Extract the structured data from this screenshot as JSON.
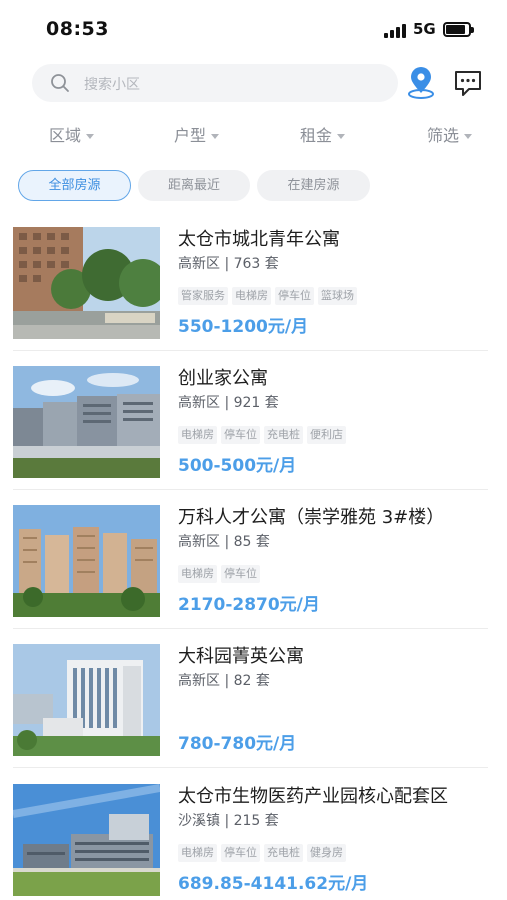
{
  "status_bar": {
    "time": "08:53",
    "network": "5G",
    "battery_level": 0.8
  },
  "search": {
    "placeholder": "搜索小区"
  },
  "filters": [
    {
      "label": "区域"
    },
    {
      "label": "户型"
    },
    {
      "label": "租金"
    },
    {
      "label": "筛选"
    }
  ],
  "chips": [
    {
      "label": "全部房源",
      "active": true
    },
    {
      "label": "距离最近",
      "active": false
    },
    {
      "label": "在建房源",
      "active": false
    }
  ],
  "listings": [
    {
      "title": "太仓市城北青年公寓",
      "subtitle": "高新区 | 763 套",
      "tags": [
        "管家服务",
        "电梯房",
        "停车位",
        "篮球场"
      ],
      "price": "550-1200元/月",
      "image": "highrise-street-photo"
    },
    {
      "title": "创业家公寓",
      "subtitle": "高新区 | 921 套",
      "tags": [
        "电梯房",
        "停车位",
        "充电桩",
        "便利店"
      ],
      "price": "500-500元/月",
      "image": "office-complex-photo"
    },
    {
      "title": "万科人才公寓（崇学雅苑 3#楼）",
      "subtitle": "高新区 | 85 套",
      "tags": [
        "电梯房",
        "停车位"
      ],
      "price": "2170-2870元/月",
      "image": "residential-towers-photo"
    },
    {
      "title": "大科园菁英公寓",
      "subtitle": "高新区 | 82 套",
      "tags": [],
      "price": "780-780元/月",
      "image": "apartment-block-photo"
    },
    {
      "title": "太仓市生物医药产业园核心配套区",
      "subtitle": "沙溪镇 | 215 套",
      "tags": [
        "电梯房",
        "停车位",
        "充电桩",
        "健身房"
      ],
      "price": "689.85-4141.62元/月",
      "image": "industrial-park-photo"
    }
  ],
  "colors": {
    "accent": "#4c9ee8",
    "chip_active_bg": "#eaf3fd",
    "text_primary": "#1e1e1e",
    "text_secondary": "#5c6068"
  }
}
